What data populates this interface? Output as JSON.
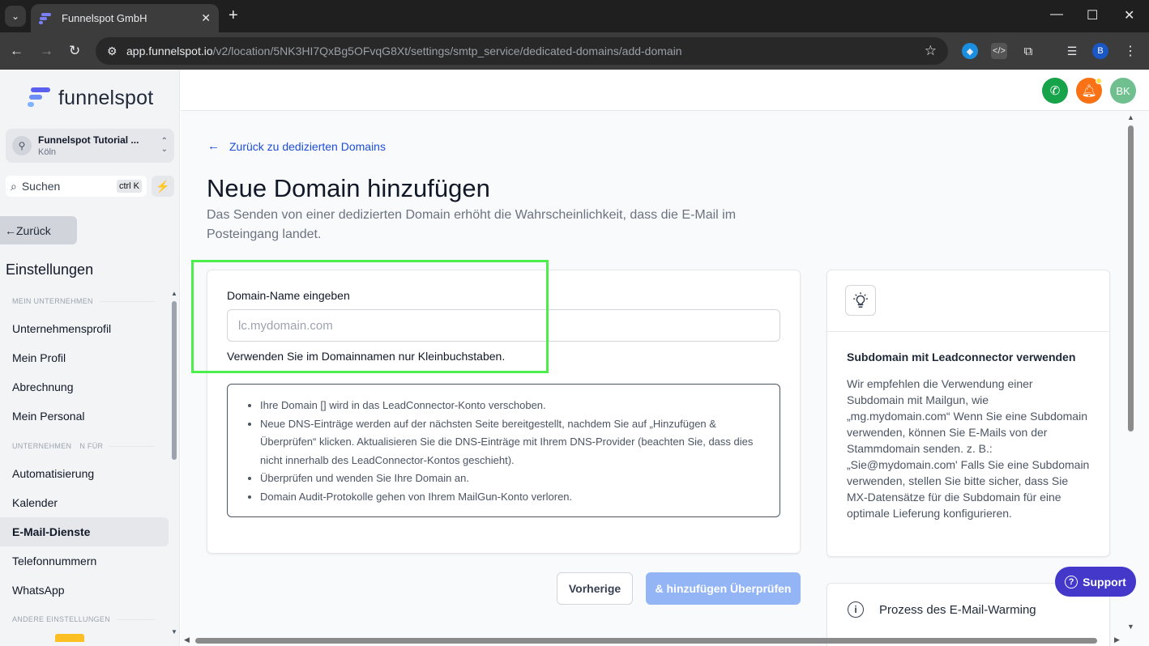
{
  "browser": {
    "tab_title": "Funnelspot GmbH",
    "url_domain": "app.funnelspot.io",
    "url_path": "/v2/location/5NK3HI7QxBg5OFvqG8Xt/settings/smtp_service/dedicated-domains/add-domain",
    "profile_initial": "B"
  },
  "sidebar": {
    "logo_text": "funnelspot",
    "location_name": "Funnelspot Tutorial ...",
    "location_city": "Köln",
    "search_label": "Suchen",
    "search_shortcut": "ctrl K",
    "back_label": "Zurück",
    "section_title": "Einstellungen",
    "group_1": "MEIN UNTERNEHMEN",
    "group_2": "UNTERNEHMEN",
    "group_2_suffix": "N FÜR",
    "group_3": "ANDERE EINSTELLUNGEN",
    "items": [
      "Unternehmensprofil",
      "Mein Profil",
      "Abrechnung",
      "Mein Personal",
      "Automatisierung",
      "Kalender",
      "E-Mail-Dienste",
      "Telefonnummern",
      "WhatsApp"
    ]
  },
  "header": {
    "avatar_initials": "BK",
    "colors": {
      "phone": "#16a34a",
      "bell": "#f97316",
      "avatar": "#6fbf8f"
    }
  },
  "main": {
    "back_link": "Zurück zu dedizierten Domains",
    "title": "Neue Domain hinzufügen",
    "subtitle": "Das Senden von einer dedizierten Domain erhöht die Wahrscheinlichkeit, dass die E-Mail im Posteingang landet.",
    "form": {
      "label": "Domain-Name eingeben",
      "placeholder": "lc.mydomain.com",
      "value": "",
      "hint": "Verwenden Sie im Domainnamen nur Kleinbuchstaben.",
      "bullets": [
        "Ihre Domain [] wird in das LeadConnector-Konto verschoben.",
        "Neue DNS-Einträge werden auf der nächsten Seite bereitgestellt, nachdem Sie auf „Hinzufügen & Überprüfen“ klicken. Aktualisieren Sie die DNS-Einträge mit Ihrem DNS-Provider (beachten Sie, dass dies nicht innerhalb des LeadConnector-Kontos geschieht).",
        "Überprüfen und wenden Sie Ihre Domain an.",
        "Domain Audit-Protokolle gehen von Ihrem MailGun-Konto verloren."
      ]
    },
    "buttons": {
      "previous": "Vorherige",
      "submit": "& hinzufügen Überprüfen"
    },
    "tip": {
      "title": "Subdomain mit Leadconnector verwenden",
      "body": "Wir empfehlen die Verwendung einer Subdomain mit Mailgun, wie „mg.mydomain.com“ Wenn Sie eine Subdomain verwenden, können Sie E-Mails von der Stammdomain senden. z. B.: „Sie@mydomain.com' Falls Sie eine Subdomain verwenden, stellen Sie bitte sicher, dass Sie MX-Datensätze für die Subdomain für eine optimale Lieferung konfigurieren."
    },
    "warming_title": "Prozess des E-Mail-Warming",
    "support_label": "Support"
  }
}
